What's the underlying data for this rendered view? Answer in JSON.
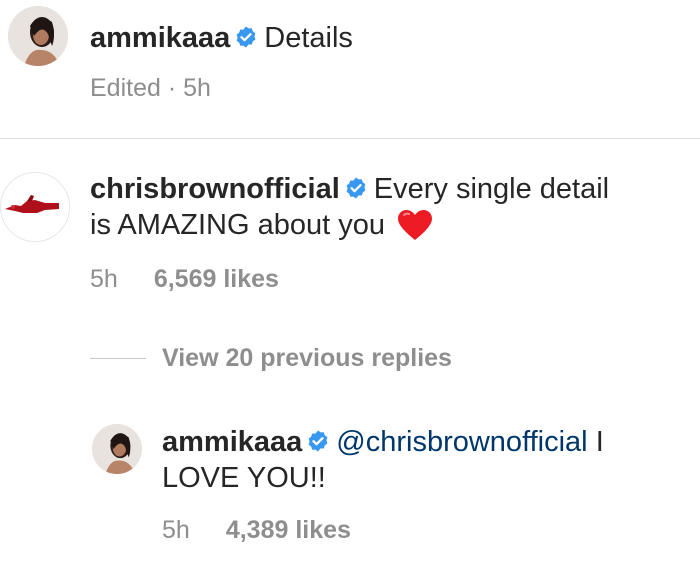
{
  "caption": {
    "username": "ammikaaa",
    "text": "Details",
    "edited": "Edited",
    "separator": "·",
    "time": "5h",
    "verified_icon": "verified-badge-icon"
  },
  "comment": {
    "username": "chrisbrownofficial",
    "text_line1": "Every single detail",
    "text_line2": "is AMAZING about you",
    "emoji": "red-heart",
    "time": "5h",
    "likes": "6,569 likes"
  },
  "replies_toggle": {
    "label": "View 20 previous replies"
  },
  "reply": {
    "username": "ammikaaa",
    "mention": "@chrisbrownofficial",
    "text_line1_tail": "I",
    "text_line2": "LOVE YOU!!",
    "time": "5h",
    "likes": "4,389 likes"
  },
  "colors": {
    "verified_blue": "#3897f0",
    "mention_blue": "#00376b",
    "secondary_text": "#8e8e8e",
    "heart_red": "#ed1c24"
  }
}
